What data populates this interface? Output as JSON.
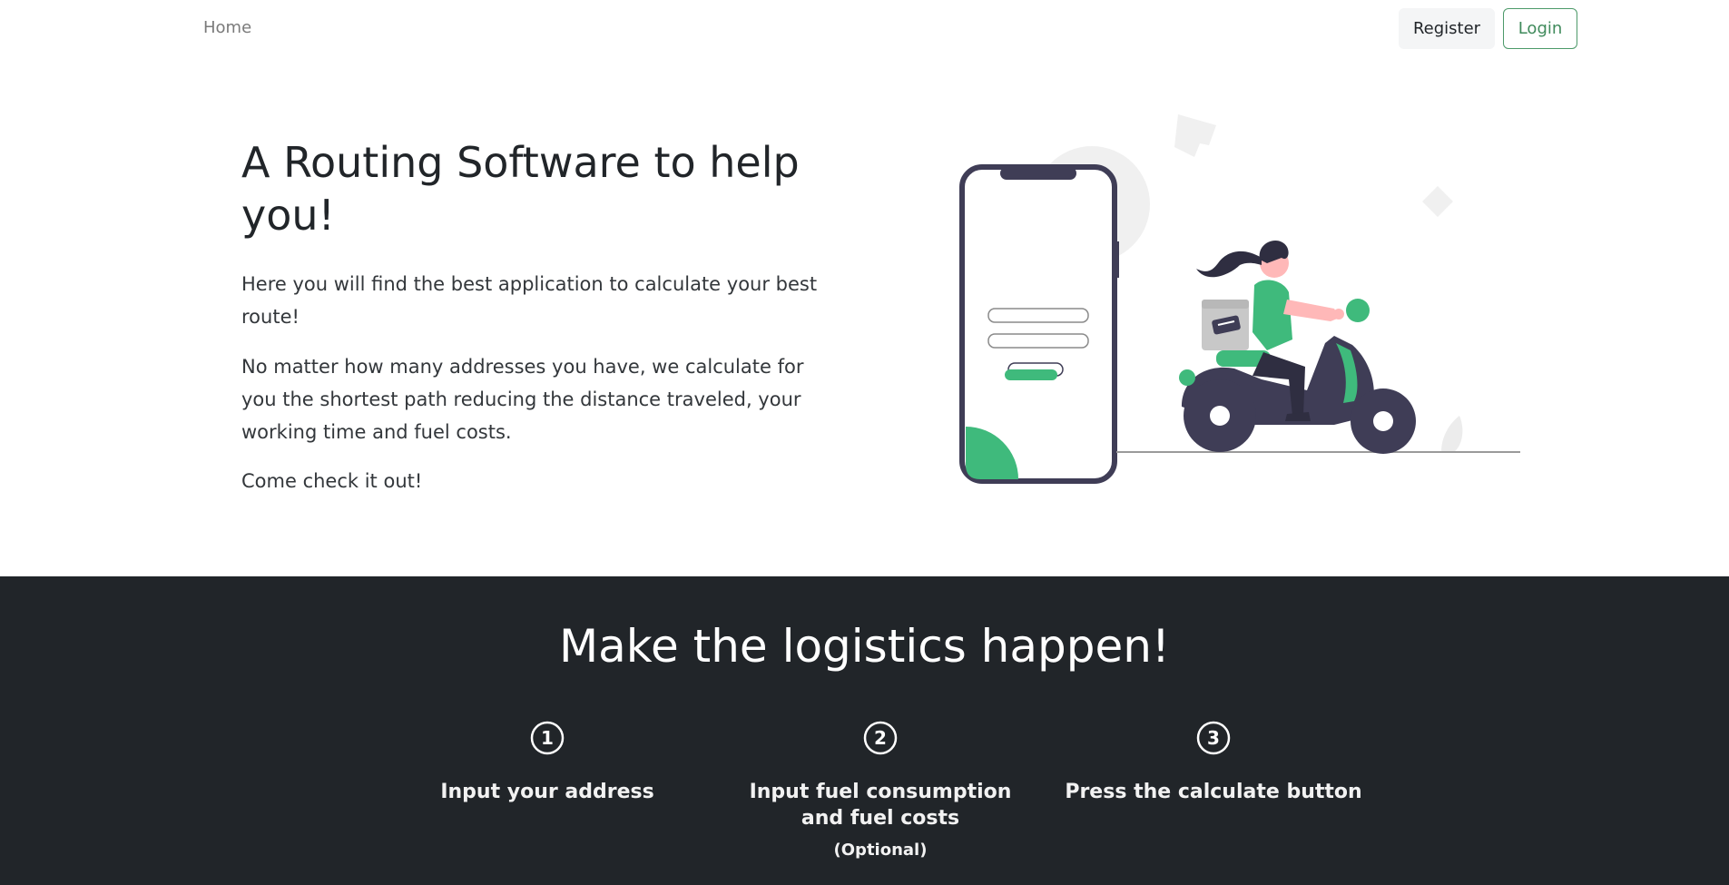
{
  "nav": {
    "home_label": "Home",
    "register_label": "Register",
    "login_label": "Login"
  },
  "hero": {
    "title": "A Routing Software to help you!",
    "paragraph_1": "Here you will find the best application to calculate your best route!",
    "paragraph_2": "No matter how many addresses you have, we calculate for you the shortest path reducing the distance traveled, your working time and fuel costs.",
    "paragraph_3": "Come check it out!",
    "illustration_icon": "delivery-scooter-phone-illustration"
  },
  "logistics": {
    "title": "Make the logistics happen!",
    "steps": [
      {
        "number": "1",
        "icon": "circled-1-icon",
        "label": "Input your address",
        "note": ""
      },
      {
        "number": "2",
        "icon": "circled-2-icon",
        "label": "Input fuel consumption and fuel costs",
        "note": "(Optional)"
      },
      {
        "number": "3",
        "icon": "circled-3-icon",
        "label": "Press the calculate button",
        "note": ""
      }
    ]
  },
  "colors": {
    "accent_green": "#3fba7c",
    "dark_bg": "#212529",
    "illustration_dark": "#3f3d56",
    "login_border": "#4d9a6a"
  }
}
